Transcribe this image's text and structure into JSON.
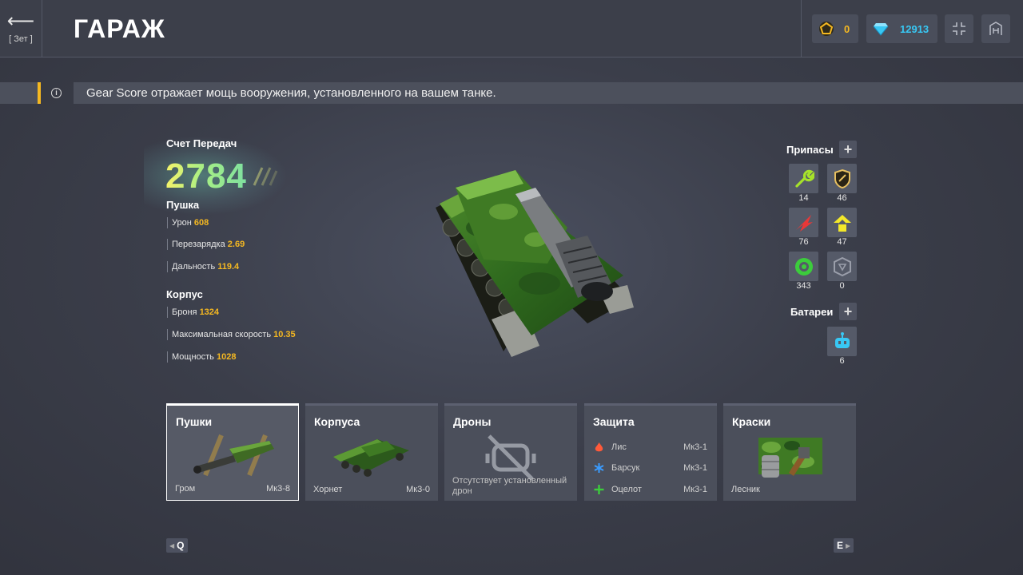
{
  "header": {
    "back_key": "[ Зет ]",
    "title": "ГАРАЖ",
    "crystals": "0",
    "diamonds": "12913"
  },
  "banner": {
    "text": "Gear Score отражает мощь вооружения, установленного на вашем танке."
  },
  "gear_score": {
    "label": "Счет Передач",
    "value": "2784"
  },
  "turret": {
    "title": "Пушка",
    "stats": [
      {
        "label": "Урон",
        "value": "608"
      },
      {
        "label": "Перезарядка",
        "value": "2.69"
      },
      {
        "label": "Дальность",
        "value": "119.4"
      }
    ]
  },
  "hull": {
    "title": "Корпус",
    "stats": [
      {
        "label": "Броня",
        "value": "1324"
      },
      {
        "label": "Максимальная скорость",
        "value": "10.35"
      },
      {
        "label": "Мощность",
        "value": "1028"
      }
    ]
  },
  "supplies": {
    "title": "Припасы",
    "plus": "+",
    "items": [
      {
        "icon": "repair-kit-icon",
        "count": "14",
        "color": "#a6e22a"
      },
      {
        "icon": "double-armor-icon",
        "count": "46",
        "color": "#e8c060"
      },
      {
        "icon": "double-damage-icon",
        "count": "76",
        "color": "#e83838"
      },
      {
        "icon": "speed-boost-icon",
        "count": "47",
        "color": "#f3e82a"
      },
      {
        "icon": "mine-icon",
        "count": "343",
        "color": "#3ccc3c"
      },
      {
        "icon": "gold-box-icon",
        "count": "0",
        "color": "#8a8e9a"
      }
    ]
  },
  "batteries": {
    "title": "Батареи",
    "plus": "+",
    "count": "6",
    "color": "#38c8f4"
  },
  "cards": {
    "turrets": {
      "title": "Пушки",
      "name": "Гром",
      "mk": "Мк3-8"
    },
    "hulls": {
      "title": "Корпуса",
      "name": "Хорнет",
      "mk": "Мк3-0"
    },
    "drones": {
      "title": "Дроны",
      "empty_text": "Отсутствует установленный дрон"
    },
    "protection": {
      "title": "Защита",
      "modules": [
        {
          "name": "Лис",
          "mk": "Мк3-1",
          "color": "#ff5a3a"
        },
        {
          "name": "Барсук",
          "mk": "Мк3-1",
          "color": "#3a9cff"
        },
        {
          "name": "Оцелот",
          "mk": "Мк3-1",
          "color": "#3ccc3c"
        }
      ]
    },
    "paints": {
      "title": "Краски",
      "name": "Лесник"
    }
  },
  "nav": {
    "prev_key": "Q",
    "next_key": "E"
  }
}
